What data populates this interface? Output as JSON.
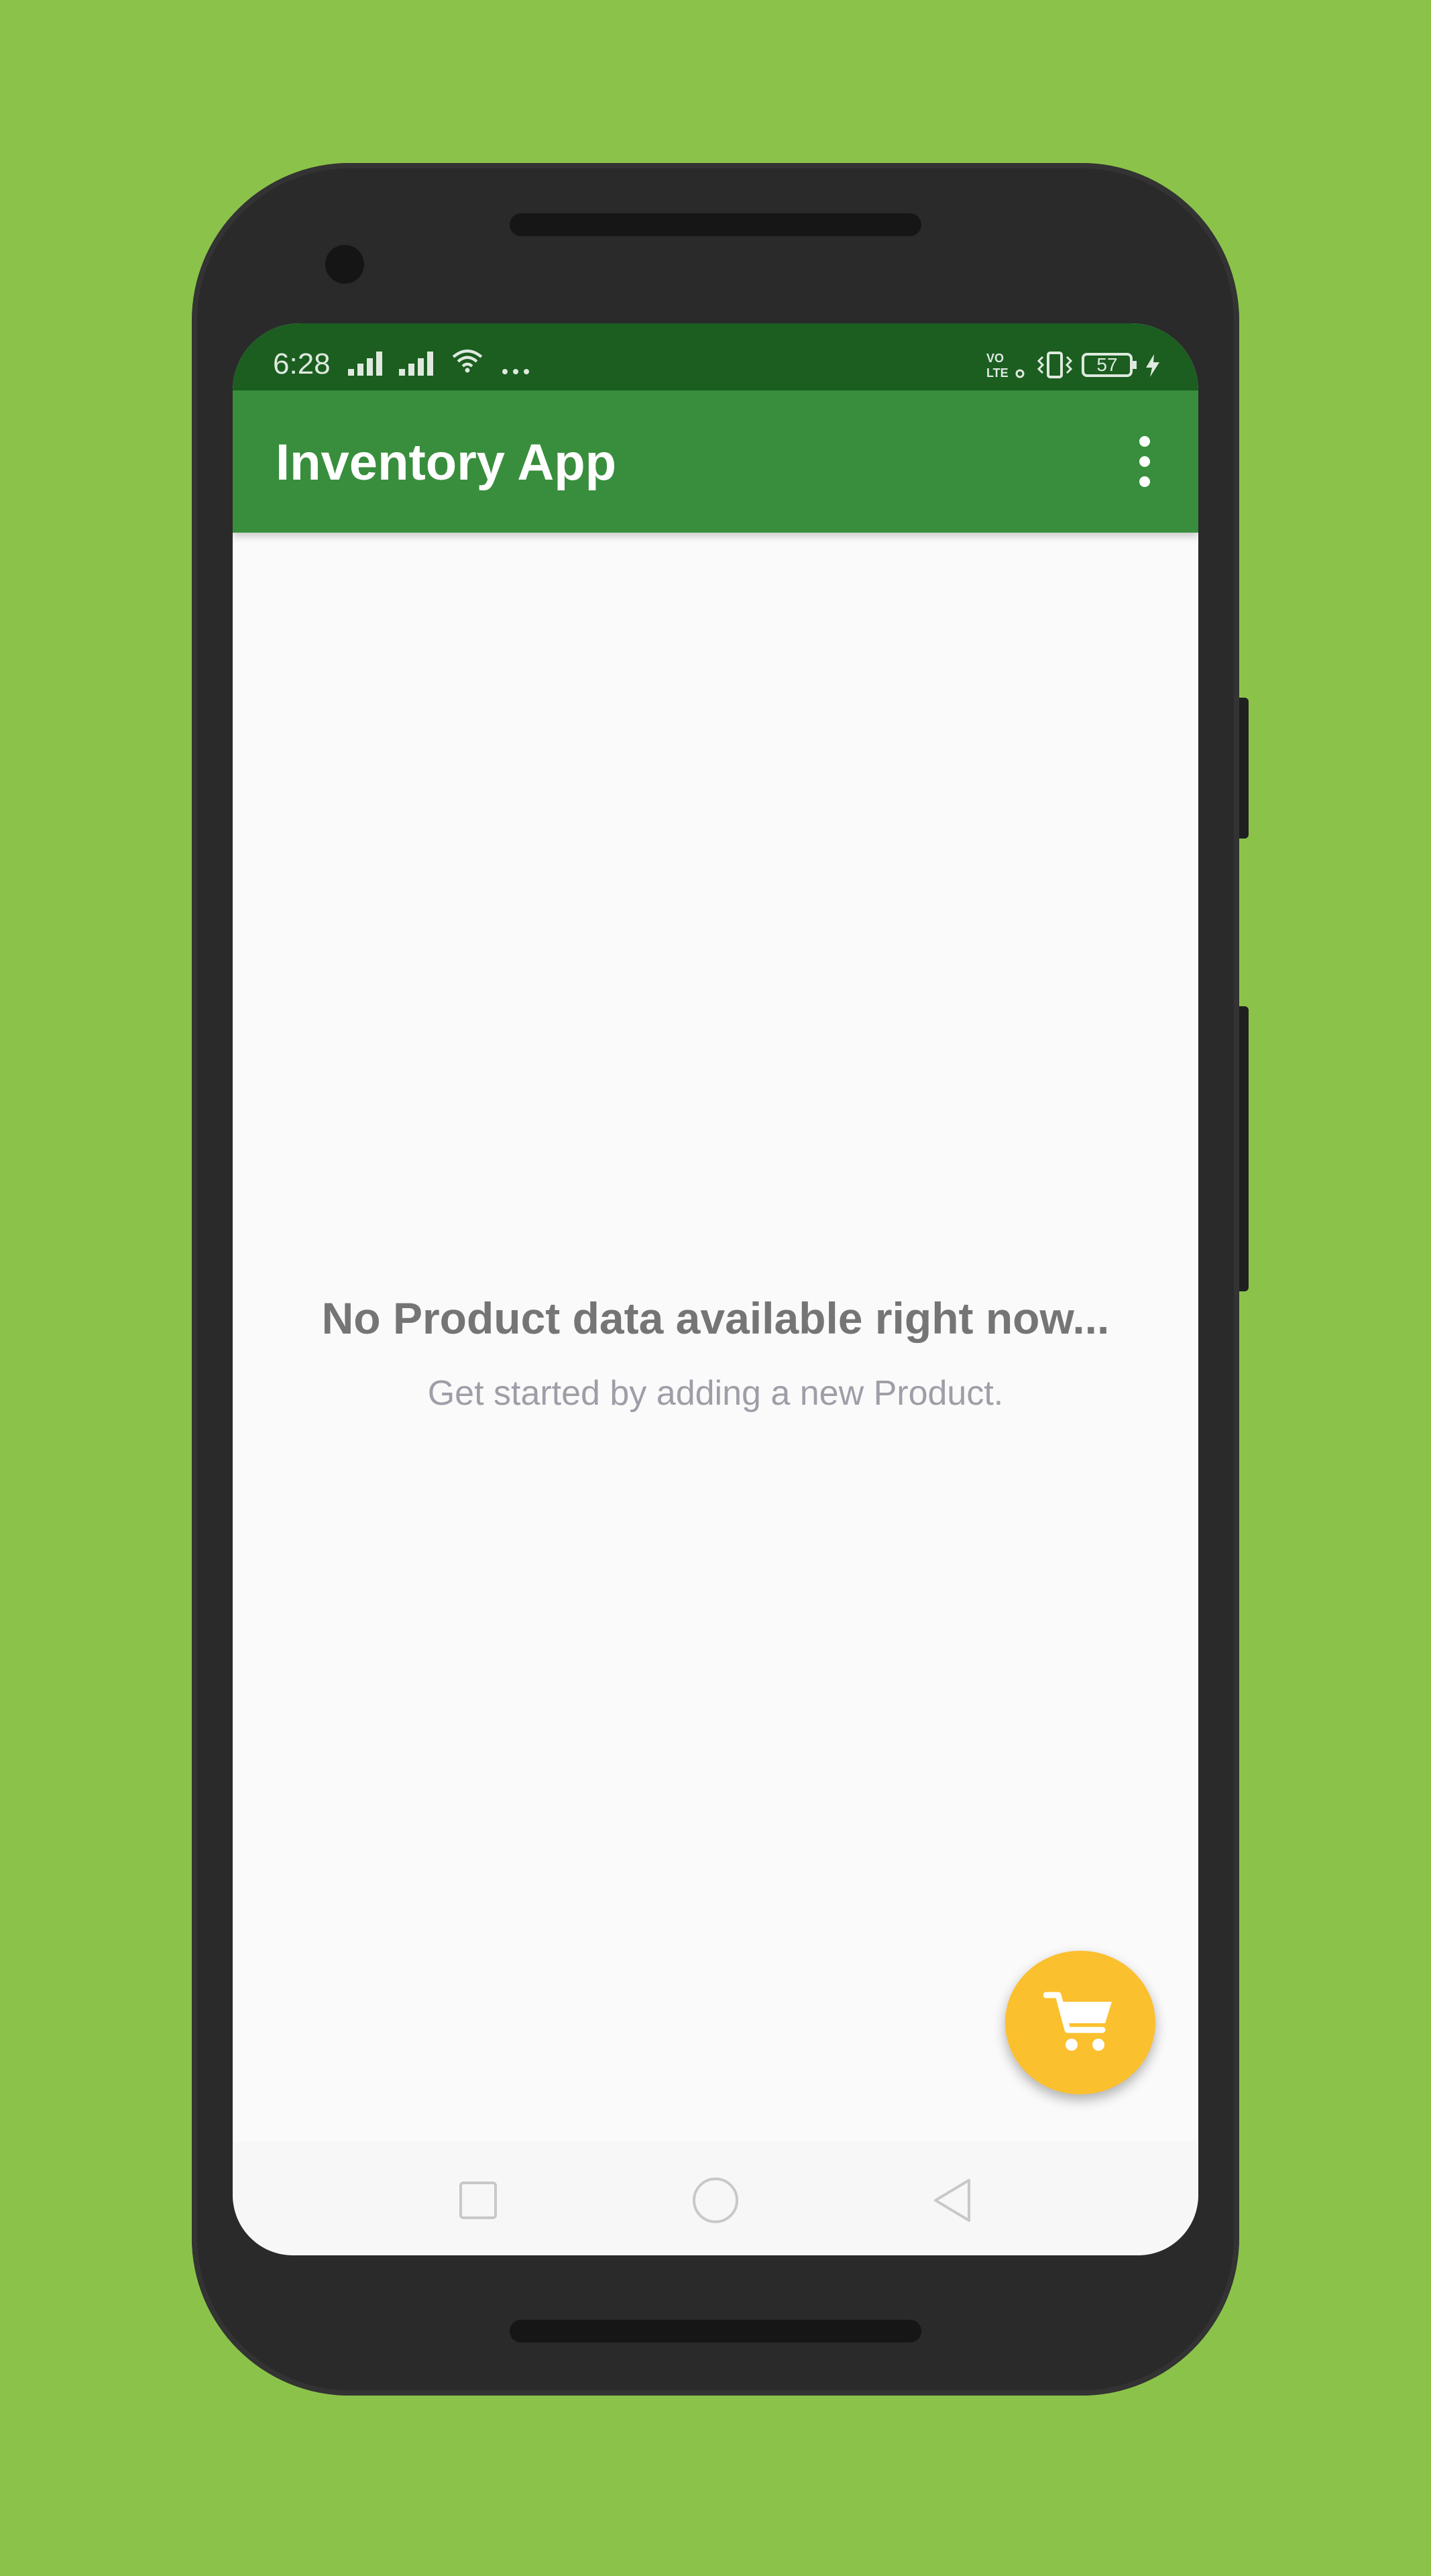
{
  "status_bar": {
    "time": "6:28",
    "battery_level": "57",
    "network_label": "VoLTE"
  },
  "app_bar": {
    "title": "Inventory App",
    "menu_icon": "more-vert-icon"
  },
  "empty_state": {
    "title": "No Product data available right now...",
    "subtitle": "Get started by adding a new Product."
  },
  "fab": {
    "icon": "shopping-cart-icon",
    "color": "#fbc02d"
  },
  "nav_bar": {
    "buttons": [
      "recents-icon",
      "home-icon",
      "back-icon"
    ]
  },
  "colors": {
    "primary": "#388e3c",
    "primary_dark": "#1b5e20",
    "accent": "#fbc02d",
    "background": "#8bc34a"
  }
}
